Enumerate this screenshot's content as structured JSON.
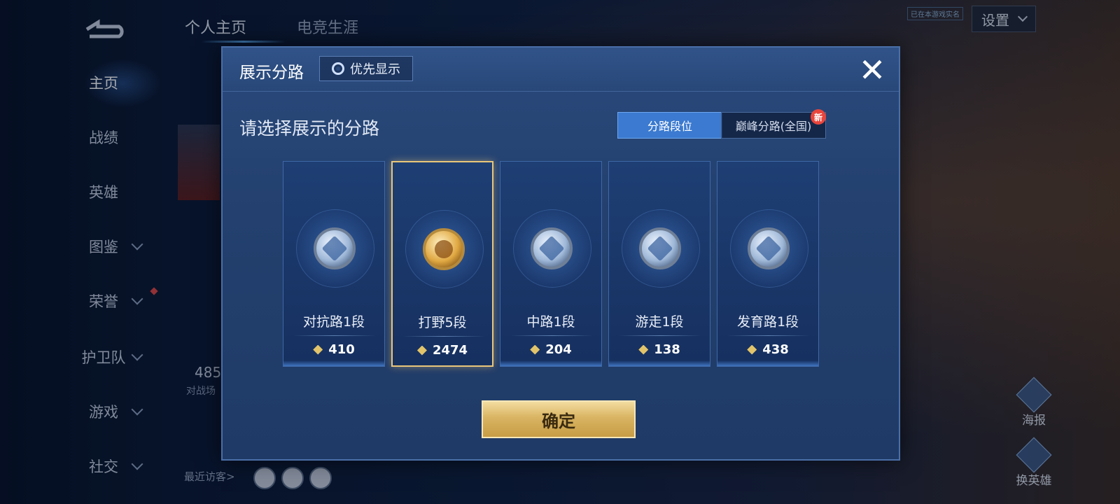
{
  "sidebar": {
    "items": [
      {
        "label": "主页",
        "has_chevron": false,
        "active": true
      },
      {
        "label": "战绩",
        "has_chevron": false
      },
      {
        "label": "英雄",
        "has_chevron": false
      },
      {
        "label": "图鉴",
        "has_chevron": true
      },
      {
        "label": "荣誉",
        "has_chevron": true
      },
      {
        "label": "护卫队",
        "has_chevron": true
      },
      {
        "label": "游戏",
        "has_chevron": true
      },
      {
        "label": "社交",
        "has_chevron": true
      }
    ]
  },
  "top_tabs": [
    {
      "label": "个人主页"
    },
    {
      "label": "电竞生涯"
    }
  ],
  "header_right": {
    "settings_label": "设置",
    "tag_text": "已在本游戏实名"
  },
  "background": {
    "stat_value": "485",
    "stat_label": "对战场",
    "recent_visitors_label": "最近访客>",
    "poster_label": "海报",
    "swap_hero_label": "换英雄"
  },
  "modal": {
    "title": "展示分路",
    "priority_button": "优先显示",
    "close_icon": "close-icon",
    "prompt": "请选择展示的分路",
    "segments": [
      {
        "label": "分路段位",
        "selected": true
      },
      {
        "label": "巅峰分路(全国)",
        "selected": false,
        "badge": "新"
      }
    ],
    "lanes": [
      {
        "name": "对抗路1段",
        "score": "410",
        "selected": false,
        "emblem": "sword-emblem-icon"
      },
      {
        "name": "打野5段",
        "score": "2474",
        "selected": true,
        "emblem": "dragon-emblem-icon"
      },
      {
        "name": "中路1段",
        "score": "204",
        "selected": false,
        "emblem": "mid-emblem-icon"
      },
      {
        "name": "游走1段",
        "score": "138",
        "selected": false,
        "emblem": "wing-emblem-icon"
      },
      {
        "name": "发育路1段",
        "score": "438",
        "selected": false,
        "emblem": "bow-emblem-icon"
      }
    ],
    "confirm_label": "确定"
  },
  "colors": {
    "accent_blue": "#3b7ad0",
    "gold": "#d9b462",
    "selected_border": "#e9c67a"
  }
}
